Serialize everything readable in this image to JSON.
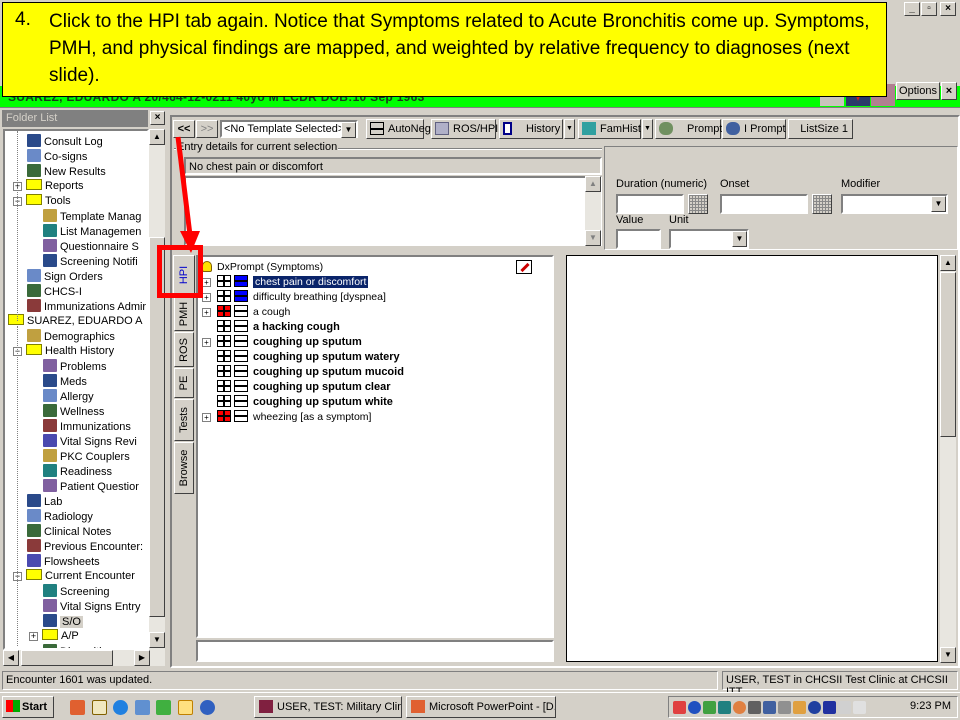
{
  "window": {
    "controls": [
      "_",
      "▫",
      "×"
    ]
  },
  "callout": {
    "number": "4.",
    "text": "Click to the HPI tab again. Notice that Symptoms related to Acute Bronchitis come up.  Symptoms, PMH, and physical findings are mapped, and weighted by relative frequency to diagnoses (next slide).",
    "background": "#ffff00"
  },
  "banner": {
    "patient_text": "SUAREZ, EDUARDO A  20/464-12-0211  40yo  M  LCDR  DOB:10 Sep 1963",
    "background": "#00ff00",
    "options_label": "Options",
    "close_label": "×"
  },
  "folder_list": {
    "title": "Folder List",
    "close_label": "×",
    "items": [
      {
        "label": "Consult Log",
        "level": 2,
        "type": "item",
        "icon": "consult-log-icon"
      },
      {
        "label": "Co-signs",
        "level": 2,
        "type": "item",
        "icon": "co-signs-icon"
      },
      {
        "label": "New Results",
        "level": 2,
        "type": "item",
        "icon": "new-results-icon"
      },
      {
        "label": "Reports",
        "level": 2,
        "type": "folder",
        "expander": "+"
      },
      {
        "label": "Tools",
        "level": 2,
        "type": "folder",
        "expander": "-"
      },
      {
        "label": "Template Manag",
        "level": 3,
        "type": "item",
        "icon": "template-manager-icon"
      },
      {
        "label": "List Managemen",
        "level": 3,
        "type": "item",
        "icon": "list-management-icon"
      },
      {
        "label": "Questionnaire S",
        "level": 3,
        "type": "item",
        "icon": "questionnaire-icon"
      },
      {
        "label": "Screening Notifi",
        "level": 3,
        "type": "item",
        "icon": "screening-notification-icon"
      },
      {
        "label": "Sign Orders",
        "level": 2,
        "type": "item",
        "icon": "sign-orders-icon"
      },
      {
        "label": "CHCS-I",
        "level": 2,
        "type": "item",
        "icon": "chcs-icon"
      },
      {
        "label": "Immunizations Admir",
        "level": 2,
        "type": "item",
        "icon": "syringe-icon"
      },
      {
        "label": "SUAREZ, EDUARDO A",
        "level": 1,
        "type": "folder",
        "expander": "-"
      },
      {
        "label": "Demographics",
        "level": 2,
        "type": "item",
        "icon": "demographics-icon"
      },
      {
        "label": "Health History",
        "level": 2,
        "type": "folder",
        "expander": "-"
      },
      {
        "label": "Problems",
        "level": 3,
        "type": "item",
        "icon": "problems-icon"
      },
      {
        "label": "Meds",
        "level": 3,
        "type": "item",
        "icon": "meds-icon"
      },
      {
        "label": "Allergy",
        "level": 3,
        "type": "item",
        "icon": "allergy-icon"
      },
      {
        "label": "Wellness",
        "level": 3,
        "type": "item",
        "icon": "wellness-icon"
      },
      {
        "label": "Immunizations",
        "level": 3,
        "type": "item",
        "icon": "syringe-icon"
      },
      {
        "label": "Vital Signs Revi",
        "level": 3,
        "type": "item",
        "icon": "vital-signs-icon"
      },
      {
        "label": "PKC Couplers",
        "level": 3,
        "type": "item",
        "icon": "pkc-couplers-icon"
      },
      {
        "label": "Readiness",
        "level": 3,
        "type": "item",
        "icon": "readiness-icon"
      },
      {
        "label": "Patient Questior",
        "level": 3,
        "type": "item",
        "icon": "patient-questionnaire-icon"
      },
      {
        "label": "Lab",
        "level": 2,
        "type": "item",
        "icon": "lab-icon"
      },
      {
        "label": "Radiology",
        "level": 2,
        "type": "item",
        "icon": "radiology-icon"
      },
      {
        "label": "Clinical Notes",
        "level": 2,
        "type": "item",
        "icon": "clinical-notes-icon"
      },
      {
        "label": "Previous Encounter:",
        "level": 2,
        "type": "item",
        "icon": "previous-encounters-icon"
      },
      {
        "label": "Flowsheets",
        "level": 2,
        "type": "item",
        "icon": "flowsheets-icon"
      },
      {
        "label": "Current Encounter",
        "level": 2,
        "type": "folder",
        "expander": "-"
      },
      {
        "label": "Screening",
        "level": 3,
        "type": "item",
        "icon": "screening-icon"
      },
      {
        "label": "Vital Signs Entry",
        "level": 3,
        "type": "item",
        "icon": "vital-signs-entry-icon"
      },
      {
        "label": "S/O",
        "level": 3,
        "type": "item",
        "icon": "so-icon",
        "selected": true
      },
      {
        "label": "A/P",
        "level": 3,
        "type": "folder",
        "expander": "+"
      },
      {
        "label": "Disposition",
        "level": 3,
        "type": "item",
        "icon": "disposition-icon"
      }
    ]
  },
  "toolbar": {
    "back_label": "<<",
    "forward_label": ">>",
    "template_value": "<No Template Selected>",
    "buttons": [
      {
        "label": "AutoNeg",
        "icon": "autoneg-icon"
      },
      {
        "label": "ROS/HPI",
        "icon": "ros-hpi-icon"
      },
      {
        "label": "History",
        "icon": "history-icon",
        "dropdown": true
      },
      {
        "label": "FamHist",
        "icon": "famhist-icon",
        "dropdown": true
      },
      {
        "label": "Prompt",
        "icon": "prompt-icon"
      },
      {
        "label": "I Prompt",
        "icon": "i-prompt-icon"
      },
      {
        "label": "ListSize 1"
      }
    ]
  },
  "entry": {
    "legend": "Entry details for current selection",
    "text_value": "No chest pain or discomfort",
    "memo_value": "",
    "duration_label": "Duration (numeric)",
    "duration_value": "",
    "onset_label": "Onset",
    "onset_value": "",
    "modifier_label": "Modifier",
    "modifier_value": "",
    "value_label": "Value",
    "value_value": "",
    "unit_label": "Unit",
    "unit_value": ""
  },
  "vertical_tabs": [
    {
      "label": "HPI",
      "active": true
    },
    {
      "label": "PMH"
    },
    {
      "label": "ROS"
    },
    {
      "label": "PE"
    },
    {
      "label": "Tests"
    },
    {
      "label": "Browse"
    }
  ],
  "dx_tree": {
    "root_label": "DxPrompt (Symptoms)",
    "items": [
      {
        "label": "chest pain or discomfort",
        "expander": true,
        "plus": "white",
        "minus": "blue",
        "bold": false,
        "selected": true
      },
      {
        "label": "difficulty breathing [dyspnea]",
        "expander": true,
        "plus": "white",
        "minus": "blue",
        "bold": false
      },
      {
        "label": "a cough",
        "expander": true,
        "plus": "red",
        "minus": "white",
        "bold": false
      },
      {
        "label": "a hacking cough",
        "expander": false,
        "plus": "white",
        "minus": "white",
        "bold": true
      },
      {
        "label": "coughing up sputum",
        "expander": true,
        "plus": "white",
        "minus": "white",
        "bold": true
      },
      {
        "label": "coughing up sputum watery",
        "expander": false,
        "plus": "white",
        "minus": "white",
        "bold": true
      },
      {
        "label": "coughing up sputum mucoid",
        "expander": false,
        "plus": "white",
        "minus": "white",
        "bold": true
      },
      {
        "label": "coughing up sputum clear",
        "expander": false,
        "plus": "white",
        "minus": "white",
        "bold": true
      },
      {
        "label": "coughing up sputum white",
        "expander": false,
        "plus": "white",
        "minus": "white",
        "bold": true
      },
      {
        "label": "wheezing [as a symptom]",
        "expander": true,
        "plus": "red",
        "minus": "white",
        "bold": false
      }
    ],
    "input_value": ""
  },
  "statusbar": {
    "message": "Encounter 1601 was updated.",
    "user_info": "USER, TEST in CHCSII Test Clinic at CHCSII ITT"
  },
  "taskbar": {
    "start_label": "Start",
    "tasks": [
      {
        "label": "USER, TEST: Military Clini...",
        "icon": "chcs-app-icon"
      },
      {
        "label": "Microsoft PowerPoint - [D...",
        "icon": "powerpoint-icon"
      }
    ],
    "clock": "9:23 PM"
  },
  "colors": {
    "highlight": "#0a246a",
    "annotation_red": "#ff0000",
    "active_tab_text": "#0000cc"
  }
}
